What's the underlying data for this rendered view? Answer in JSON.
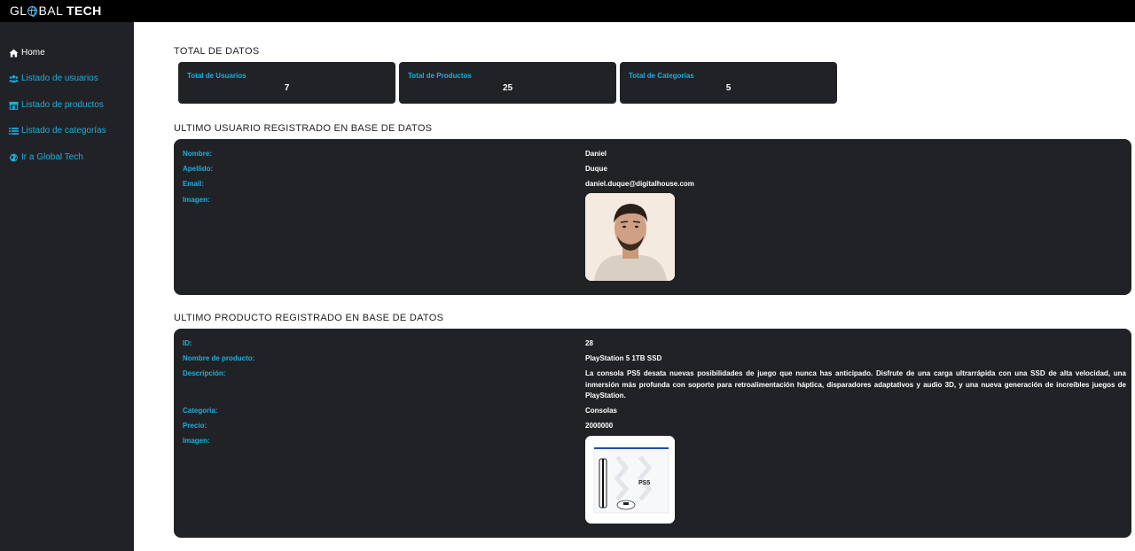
{
  "brand": {
    "logo_light_a": "GL",
    "logo_light_b": "BAL",
    "logo_bold": "TECH"
  },
  "sidebar": {
    "items": [
      {
        "label": "Home",
        "icon": "home-icon"
      },
      {
        "label": "Listado de usuarios",
        "icon": "users-icon"
      },
      {
        "label": "Listado de productos",
        "icon": "store-icon"
      },
      {
        "label": "Listado de categorías",
        "icon": "list-icon"
      },
      {
        "label": "Ir a Global Tech",
        "icon": "globe-icon"
      }
    ]
  },
  "totals": {
    "title": "TOTAL DE DATOS",
    "cards": [
      {
        "label": "Total de Usuarios",
        "value": "7"
      },
      {
        "label": "Total de Productos",
        "value": "25"
      },
      {
        "label": "Total de Categorías",
        "value": "5"
      }
    ]
  },
  "last_user": {
    "title": "ULTIMO USUARIO REGISTRADO EN BASE DE DATOS",
    "labels": {
      "nombre": "Nombre:",
      "apellido": "Apellido:",
      "email": "Email:",
      "imagen": "Imagen:"
    },
    "values": {
      "nombre": "Daniel",
      "apellido": "Duque",
      "email": "daniel.duque@digitalhouse.com"
    }
  },
  "last_product": {
    "title": "ULTIMO PRODUCTO REGISTRADO EN BASE DE DATOS",
    "labels": {
      "id": "ID:",
      "nombre": "Nombre de producto:",
      "descripcion": "Descripción:",
      "categoria": "Categoria:",
      "precio": "Precio:",
      "imagen": "Imagen:"
    },
    "values": {
      "id": "28",
      "nombre": "PlayStation 5 1TB SSD",
      "descripcion": "La consola PS5 desata nuevas posibilidades de juego que nunca has anticipado. Disfrute de una carga ultrarrápida con una SSD de alta velocidad, una inmersión más profunda con soporte para retroalimentación háptica, disparadores adaptativos y audio 3D, y una nueva generación de increíbles juegos de PlayStation.",
      "categoria": "Consolas",
      "precio": "2000000"
    },
    "image_text": "PS5"
  },
  "colors": {
    "accent": "#1eaedb",
    "panel": "#212226",
    "topbar": "#000000",
    "sidebar": "#212226"
  }
}
